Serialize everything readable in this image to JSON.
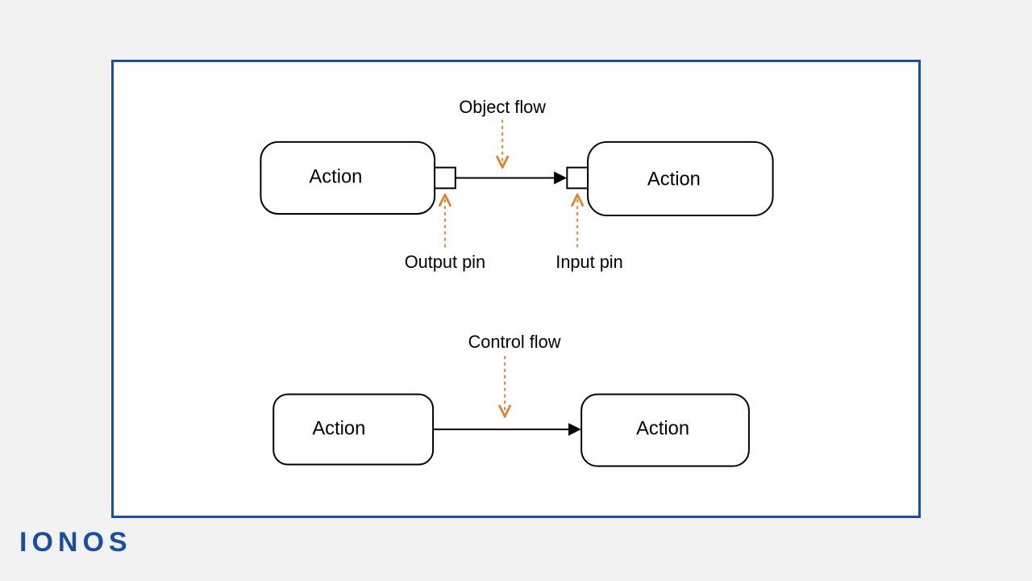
{
  "logo": "IONOS",
  "diagram": {
    "objectFlow": {
      "title": "Object flow",
      "leftAction": "Action",
      "rightAction": "Action",
      "outputPinLabel": "Output pin",
      "inputPinLabel": "Input pin"
    },
    "controlFlow": {
      "title": "Control flow",
      "leftAction": "Action",
      "rightAction": "Action"
    }
  }
}
